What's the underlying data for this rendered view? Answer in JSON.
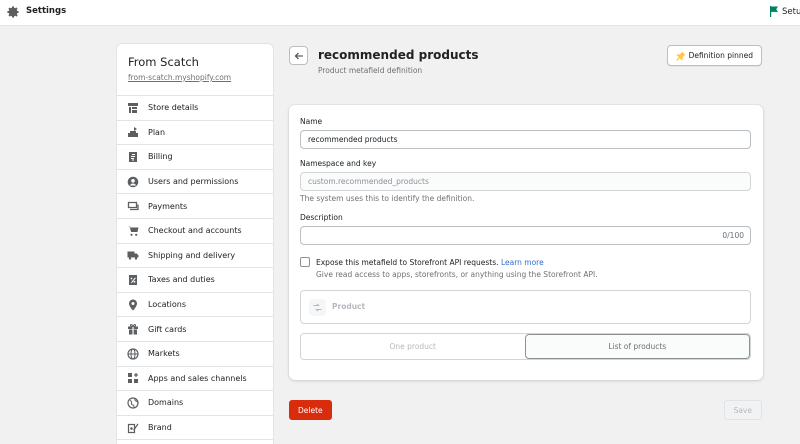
{
  "topbar": {
    "title": "Settings",
    "setup_label": "Setu",
    "flag_color": "#008060"
  },
  "sidebar": {
    "store_name": "From Scatch",
    "store_url": "from-scatch.myshopify.com",
    "items": [
      {
        "label": "Store details",
        "icon": "store-icon"
      },
      {
        "label": "Plan",
        "icon": "plan-icon"
      },
      {
        "label": "Billing",
        "icon": "billing-icon"
      },
      {
        "label": "Users and permissions",
        "icon": "user-icon"
      },
      {
        "label": "Payments",
        "icon": "payments-icon"
      },
      {
        "label": "Checkout and accounts",
        "icon": "cart-icon"
      },
      {
        "label": "Shipping and delivery",
        "icon": "truck-icon"
      },
      {
        "label": "Taxes and duties",
        "icon": "tax-icon"
      },
      {
        "label": "Locations",
        "icon": "location-icon"
      },
      {
        "label": "Gift cards",
        "icon": "gift-icon"
      },
      {
        "label": "Markets",
        "icon": "globe-icon"
      },
      {
        "label": "Apps and sales channels",
        "icon": "apps-icon"
      },
      {
        "label": "Domains",
        "icon": "domains-icon"
      },
      {
        "label": "Brand",
        "icon": "brand-icon"
      }
    ]
  },
  "header": {
    "title": "recommended products",
    "subtitle": "Product metafield definition",
    "pin_label": "Definition pinned"
  },
  "form": {
    "name_label": "Name",
    "name_value": "recommended products",
    "namespace_label": "Namespace and key",
    "namespace_value": "custom.recommended_products",
    "namespace_help": "The system uses this to identify the definition.",
    "description_label": "Description",
    "description_value": "",
    "description_counter": "0/100",
    "expose_label": "Expose this metafield to Storefront API requests.",
    "expose_link": "Learn more",
    "expose_help": "Give read access to apps, storefronts, or anything using the Storefront API.",
    "expose_checked": false,
    "reference_type": "Product",
    "option_one": "One product",
    "option_list": "List of products",
    "selected_option": "List of products"
  },
  "footer": {
    "delete_label": "Delete",
    "save_label": "Save"
  },
  "colors": {
    "accent_red": "#d82c0d",
    "link_blue": "#2c6ecb"
  }
}
